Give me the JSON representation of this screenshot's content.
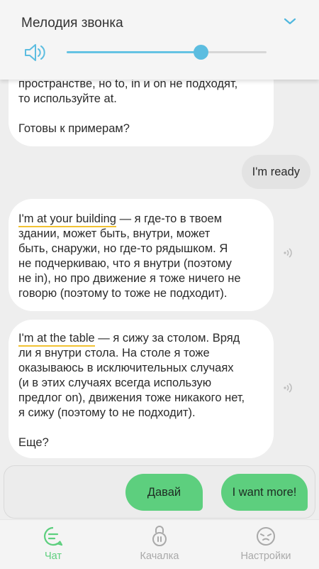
{
  "ringtone_panel": {
    "title": "Мелодия звонка",
    "volume_fraction": 0.67
  },
  "chat": {
    "messages": [
      {
        "lines": [
          "пространстве, но to, in и on не подходят,",
          "то используйте at.",
          "",
          "Готовы к примерам?"
        ]
      },
      {
        "user_text": "I'm ready"
      },
      {
        "highlight": "I'm at your building",
        "first_rest": " — я где-то в твоем",
        "lines": [
          "здании, может быть, внутри, может",
          "быть, снаружи, но где-то рядышком. Я",
          "не подчеркиваю, что я внутри (поэтому",
          "не in), но про движение я тоже ничего не",
          "говорю (поэтому to тоже не подходит)."
        ]
      },
      {
        "highlight": "I'm at the table",
        "first_rest": " — я сижу за столом. Вряд",
        "lines": [
          "ли я внутри стола. На столе я тоже",
          "оказываюсь в исключительных случаях",
          "(и в этих случаях всегда использую",
          "предлог on), движения тоже никакого нет,",
          "я сижу (поэтому to не подходит).",
          "",
          "Еще?"
        ]
      }
    ]
  },
  "replies": [
    "Давай",
    "I want more!"
  ],
  "nav": [
    {
      "label": "Чат",
      "icon": "chat-icon",
      "active": true
    },
    {
      "label": "Качалка",
      "icon": "kettlebell-icon",
      "active": false
    },
    {
      "label": "Настройки",
      "icon": "settings-face-icon",
      "active": false
    }
  ],
  "colors": {
    "accent_green": "#5dcf7e",
    "slider_blue": "#5cbde0",
    "highlight_yellow": "#f2c232"
  }
}
